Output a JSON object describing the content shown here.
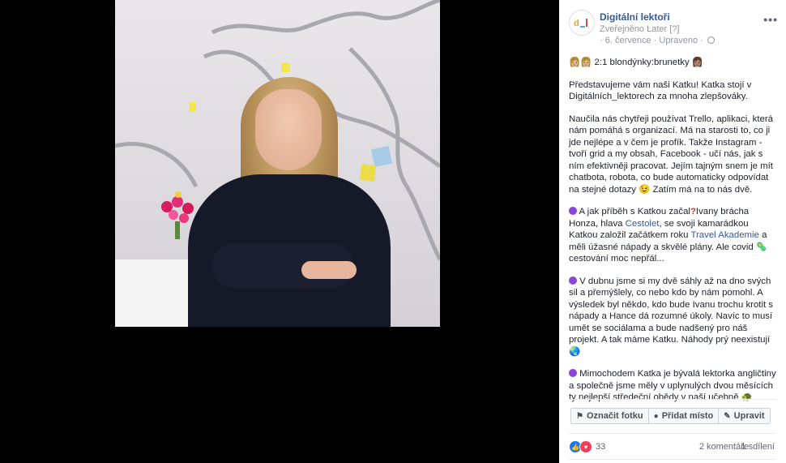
{
  "post": {
    "page_name": "Digitální lektoři",
    "published_via": "Zveřejněno Later [?]",
    "date": "6. července",
    "edited": "Upraveno",
    "menu": "•••",
    "line1": "2:1 blondýnky:brunetky",
    "p1": "Představujeme vám naši Katku! Katka stojí v Digitálních_lektorech za mnoha zlepšováky.",
    "p2": "Naučila nás chytřeji používat Trello, aplikaci, která nám pomáhá s organizací. Má na starosti to, co ji jde nejlépe a v čem je profík. Takže Instagram - tvoří grid a my obsah, Facebook - učí nás, jak s ním efektivněji pracovat. Jejím tajným snem je mít chatbota, robota, co bude automaticky odpovídat na stejné dotazy",
    "p2_end": "Zatím má na to nás dvě.",
    "p3_a": "A jak příběh s Katkou začal",
    "p3_b": "Ivany brácha Honza, hlava",
    "p3_link1": "Cestolet",
    "p3_c": ", se svoji kamarádkou Katkou založil začátkem roku",
    "p3_link2": "Travel Akademie",
    "p3_d": "a měli úžasné nápady a skvělé plány. Ale covid",
    "p3_e": "cestování moc nepřál...",
    "p4": "V dubnu jsme si my dvě sáhly až na dno svých sil a přemýšlely, co nebo kdo by nám pomohl. A výsledek byl někdo, kdo bude Ivanu trochu krotit s nápady a Hance dá rozumné úkoly. Navíc to musí umět se sociálama a bude nadšený pro náš projekt. A tak máme Katku. Náhody prý neexistují",
    "p5": "Mimochodem Katka je bývalá lektorka angličtiny a společně jsme měly v uplynulých dvou měsících ty nejlepší středeční obědy v naší učebně"
  },
  "actions": {
    "tag": "Označit fotku",
    "place": "Přidat místo",
    "edit": "Upravit"
  },
  "footer": {
    "reactions": "33",
    "comments": "2 komentáře",
    "shares": "1 sdílení"
  },
  "icons": {
    "tag": "tag-icon",
    "place": "location-pin-icon",
    "edit": "pencil-icon",
    "like": "like-icon",
    "love": "love-icon",
    "globe": "globe-icon"
  }
}
